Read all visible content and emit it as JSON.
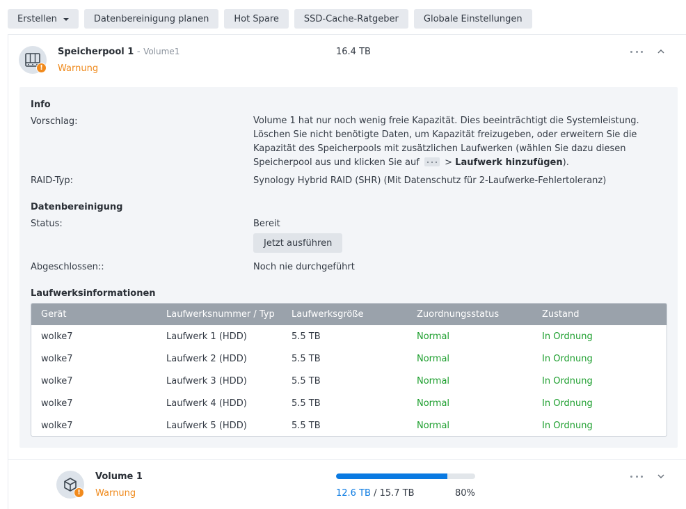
{
  "toolbar": {
    "create_label": "Erstellen",
    "schedule_scrub_label": "Datenbereinigung planen",
    "hot_spare_label": "Hot Spare",
    "ssd_cache_label": "SSD-Cache-Ratgeber",
    "global_settings_label": "Globale Einstellungen"
  },
  "pool": {
    "name": "Speicherpool 1",
    "separator": "-",
    "volume_ref": "Volume1",
    "status": "Warnung",
    "capacity": "16.4 TB",
    "info": {
      "section_title": "Info",
      "suggestion_label": "Vorschlag:",
      "suggestion_text_before": "Volume 1 hat nur noch wenig freie Kapazität. Dies beeinträchtigt die Systemleistung. Löschen Sie nicht benötigte Daten, um Kapazität freizugeben, oder erweitern Sie die Kapazität des Speicherpools mit zusätzlichen Laufwerken (wählen Sie dazu diesen Speicherpool aus und klicken Sie auf",
      "suggestion_arrow": ">",
      "suggestion_action": "Laufwerk hinzufügen",
      "suggestion_text_after": ").",
      "raid_label": "RAID-Typ:",
      "raid_value": "Synology Hybrid RAID (SHR) (Mit Datenschutz für 2-Laufwerke-Fehlertoleranz)"
    },
    "scrubbing": {
      "section_title": "Datenbereinigung",
      "status_label": "Status:",
      "status_value": "Bereit",
      "run_now_label": "Jetzt ausführen",
      "completed_label": "Abgeschlossen::",
      "completed_value": "Noch nie durchgeführt"
    },
    "drives": {
      "section_title": "Laufwerksinformationen",
      "columns": [
        "Gerät",
        "Laufwerksnummer / Typ",
        "Laufwerksgröße",
        "Zuordnungsstatus",
        "Zustand"
      ],
      "rows": [
        {
          "device": "wolke7",
          "drive": "Laufwerk 1 (HDD)",
          "size": "5.5 TB",
          "allocation": "Normal",
          "health": "In Ordnung"
        },
        {
          "device": "wolke7",
          "drive": "Laufwerk 2 (HDD)",
          "size": "5.5 TB",
          "allocation": "Normal",
          "health": "In Ordnung"
        },
        {
          "device": "wolke7",
          "drive": "Laufwerk 3 (HDD)",
          "size": "5.5 TB",
          "allocation": "Normal",
          "health": "In Ordnung"
        },
        {
          "device": "wolke7",
          "drive": "Laufwerk 4 (HDD)",
          "size": "5.5 TB",
          "allocation": "Normal",
          "health": "In Ordnung"
        },
        {
          "device": "wolke7",
          "drive": "Laufwerk 5 (HDD)",
          "size": "5.5 TB",
          "allocation": "Normal",
          "health": "In Ordnung"
        }
      ]
    }
  },
  "volume": {
    "name": "Volume 1",
    "status": "Warnung",
    "used": "12.6 TB",
    "separator": "/",
    "total": "15.7 TB",
    "percent_label": "80%",
    "usage_fraction": 0.8
  },
  "colors": {
    "warning": "#ef8a1c",
    "ok": "#1c9e2d",
    "accent": "#0a7ae2",
    "table_header": "#9aa2ab"
  },
  "icons": {
    "pool": "storage-pool-icon",
    "volume": "volume-cube-icon",
    "warning": "warning-icon",
    "more": "more-icon",
    "collapse": "chevron-up-icon",
    "expand": "chevron-down-icon"
  }
}
